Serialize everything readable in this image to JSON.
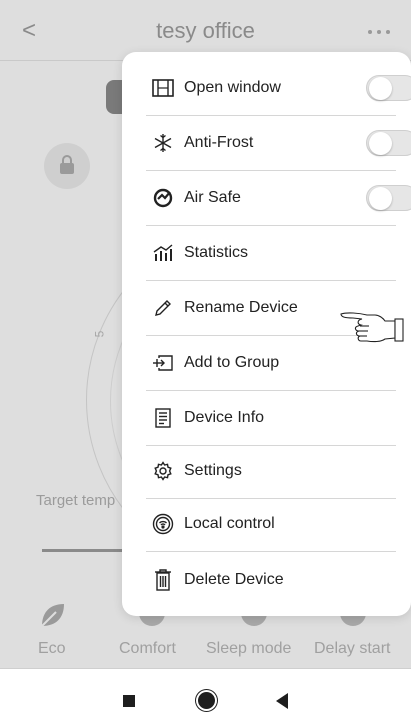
{
  "header": {
    "title": "tesy office",
    "back_glyph": "<",
    "more_icon": "more-dots-icon"
  },
  "background": {
    "dial_tick_label": "5",
    "target_label": "Target temp",
    "modes": [
      {
        "label": "Eco"
      },
      {
        "label": "Comfort"
      },
      {
        "label": "Sleep mode"
      },
      {
        "label": "Delay start"
      }
    ]
  },
  "menu": {
    "items": [
      {
        "label": "Open window",
        "icon": "window-icon",
        "toggle": true,
        "toggle_on": false
      },
      {
        "label": "Anti-Frost",
        "icon": "snowflake-icon",
        "toggle": true,
        "toggle_on": false
      },
      {
        "label": "Air Safe",
        "icon": "air-safe-icon",
        "toggle": true,
        "toggle_on": false
      },
      {
        "label": "Statistics",
        "icon": "statistics-icon",
        "toggle": false
      },
      {
        "label": "Rename Device",
        "icon": "pencil-icon",
        "toggle": false
      },
      {
        "label": "Add to Group",
        "icon": "add-to-group-icon",
        "toggle": false
      },
      {
        "label": "Device Info",
        "icon": "device-info-icon",
        "toggle": false
      },
      {
        "label": "Settings",
        "icon": "gear-icon",
        "toggle": false
      },
      {
        "label": "Local control",
        "icon": "local-control-icon",
        "toggle": false
      },
      {
        "label": "Delete Device",
        "icon": "trash-icon",
        "toggle": false
      }
    ]
  },
  "colors": {
    "overlay": "#dedede",
    "menu_bg": "#ffffff",
    "text": "#222222",
    "toggle_off": "#e6e6e6"
  },
  "navbar": {
    "icons": [
      "recents-square-icon",
      "home-circle-icon",
      "back-triangle-icon"
    ]
  }
}
